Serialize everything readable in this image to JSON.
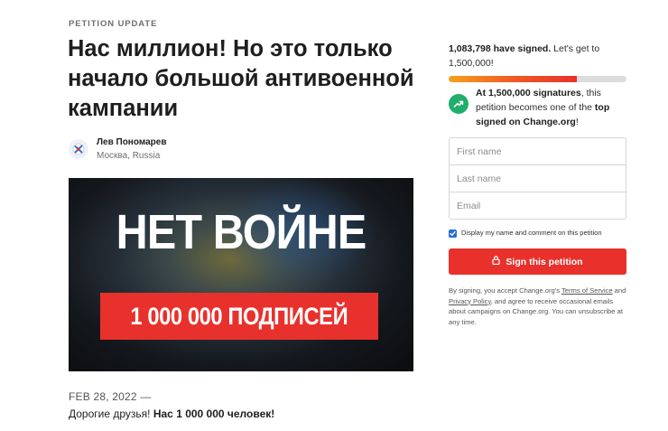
{
  "update": {
    "kicker": "PETITION UPDATE",
    "title": "Нас миллион! Но это только начало большой антивоенной кампании",
    "author": {
      "name": "Лев Пономарев",
      "location": "Москва, Russia",
      "avatar_icon": "author-avatar-icon"
    },
    "hero": {
      "headline": "НЕТ ВОЙНЕ",
      "band_text": "1 000 000 ПОДПИСЕЙ"
    },
    "date": "FEB 28, 2022 —",
    "body_prefix": "Дорогие друзья! ",
    "body_bold": "Нас 1 000 000 человек!"
  },
  "sidebar": {
    "signed_count": "1,083,798 have signed.",
    "signed_suffix": " Let's get to 1,500,000!",
    "progress_fraction": 0.72,
    "goal_bold": "At 1,500,000 signatures",
    "goal_text": ", this petition becomes one of the ",
    "goal_top": "top signed on Change.org",
    "goal_end": "!",
    "goal_icon": "trending-up-icon",
    "form": {
      "first_name_placeholder": "First name",
      "last_name_placeholder": "Last name",
      "email_placeholder": "Email"
    },
    "display_checkbox": {
      "label": "Display my name and comment on this petition",
      "checked": true
    },
    "sign_button": "Sign this petition",
    "sign_button_icon": "lock-icon",
    "disclaimer": {
      "prefix": "By signing, you accept Change.org's ",
      "terms": "Terms of Service",
      "and": " and ",
      "privacy": "Privacy Policy",
      "suffix": ", and agree to receive occasional emails about campaigns on Change.org. You can unsubscribe at any time."
    }
  },
  "colors": {
    "accent": "#e8312c",
    "progress_start": "#f7a21b",
    "goal_green": "#1fae6b",
    "checkbox": "#2a6ecf"
  }
}
